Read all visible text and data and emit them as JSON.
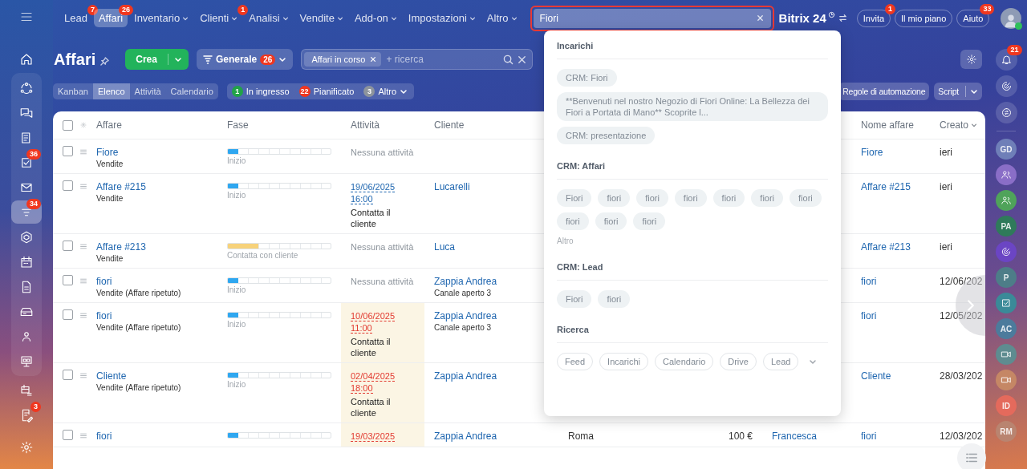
{
  "topbar": {
    "nav": [
      {
        "label": "Lead",
        "badge": "7",
        "selected": false,
        "dropdown": false
      },
      {
        "label": "Affari",
        "badge": "26",
        "selected": true,
        "dropdown": false
      },
      {
        "label": "Inventario",
        "selected": false,
        "dropdown": true
      },
      {
        "label": "Clienti",
        "badge": "1",
        "selected": false,
        "dropdown": true
      },
      {
        "label": "Analisi",
        "selected": false,
        "dropdown": true
      },
      {
        "label": "Vendite",
        "selected": false,
        "dropdown": true
      },
      {
        "label": "Add-on",
        "selected": false,
        "dropdown": true
      },
      {
        "label": "Impostazioni",
        "selected": false,
        "dropdown": true
      },
      {
        "label": "Altro",
        "selected": false,
        "dropdown": true
      }
    ],
    "search": {
      "value": "Fiori",
      "highlighted": true
    },
    "logo": {
      "name": "Bitrix",
      "number": "24"
    },
    "buttons": [
      {
        "label": "Invita",
        "badge": "1"
      },
      {
        "label": "Il mio piano"
      },
      {
        "label": "Aiuto",
        "badge": "33"
      }
    ]
  },
  "sidebar": {
    "home": {
      "kind": "home",
      "selected": false
    },
    "group": [
      {
        "kind": "network",
        "selected": false
      },
      {
        "kind": "chat",
        "selected": false
      },
      {
        "kind": "news",
        "selected": false
      },
      {
        "kind": "task",
        "badge": "36",
        "selected": false
      },
      {
        "kind": "mail",
        "selected": false
      },
      {
        "kind": "funnel",
        "badge": "34",
        "selected": true
      },
      {
        "kind": "hexagon",
        "selected": false
      },
      {
        "kind": "calendar",
        "selected": false
      },
      {
        "kind": "document",
        "selected": false
      },
      {
        "kind": "drive",
        "selected": false
      },
      {
        "kind": "people",
        "selected": false
      },
      {
        "kind": "board",
        "selected": false
      }
    ],
    "rest": [
      {
        "kind": "calendar-list",
        "selected": false
      },
      {
        "kind": "edit",
        "badge": "3",
        "selected": false
      }
    ],
    "settings": {
      "kind": "gear",
      "selected": false
    }
  },
  "header": {
    "title": "Affari",
    "create": "Crea",
    "filter": {
      "label": "Generale",
      "badge": "26"
    },
    "search": {
      "chips": [
        "Affari in corso"
      ],
      "placeholder": "+ ricerca"
    },
    "views": [
      {
        "label": "Kanban",
        "selected": false
      },
      {
        "label": "Elenco",
        "selected": true
      },
      {
        "label": "Attività",
        "selected": false
      },
      {
        "label": "Calendario",
        "selected": false
      }
    ],
    "counters": [
      {
        "count": "1",
        "label": "In ingresso",
        "color": "#21a348",
        "dropdown": false
      },
      {
        "count": "22",
        "label": "Pianificato",
        "color": "#f0371f",
        "dropdown": false
      },
      {
        "count": "3",
        "label": "Altro",
        "color": "#8d949c",
        "dropdown": true
      }
    ],
    "automation": "Regole di automazione",
    "script": "Script"
  },
  "table": {
    "select_all": {
      "checked": false
    },
    "headers": {
      "deal": "Affare",
      "stage": "Fase",
      "activity": "Attività",
      "client": "Cliente",
      "deal_name": "Nome affare",
      "created": "Creato"
    },
    "rows": [
      {
        "checked": false,
        "name": "Fiore",
        "pipeline": "Vendite",
        "stage": {
          "level": 0.1,
          "label": "Inizio",
          "color": "#2fa7f0"
        },
        "activity": {
          "kind": "none",
          "text": "Nessuna attività"
        },
        "deal_name": "Fiore",
        "created": "ieri"
      },
      {
        "checked": false,
        "name": "Affare #215",
        "pipeline": "Vendite",
        "stage": {
          "level": 0.1,
          "label": "Inizio",
          "color": "#2fa7f0"
        },
        "activity": {
          "kind": "scheduled",
          "date": "19/06/2025",
          "time": "16:00",
          "text": "Contatta il cliente",
          "overdue": false
        },
        "client": "Lucarelli",
        "deal_name": "Affare #215",
        "created": "ieri"
      },
      {
        "checked": false,
        "name": "Affare #213",
        "pipeline": "Vendite",
        "stage": {
          "level": 0.3,
          "label": "Contatta con cliente",
          "color": "#f7d27a"
        },
        "activity": {
          "kind": "none",
          "text": "Nessuna attività"
        },
        "client": "Luca",
        "deal_name": "Affare #213",
        "created": "ieri"
      },
      {
        "name": "fiori",
        "pipeline": "Vendite (Affare ripetuto)",
        "stage": {
          "level": 0.1,
          "label": "Inizio",
          "color": "#2fa7f0"
        },
        "activity": {
          "kind": "none",
          "text": "Nessuna attività"
        },
        "checked": false,
        "client": "Zappia Andrea",
        "client_sub": "Canale aperto 3",
        "deal_name": "fiori",
        "created": "12/06/202"
      },
      {
        "name": "fiori",
        "pipeline": "Vendite (Affare ripetuto)",
        "stage": {
          "level": 0.1,
          "label": "Inizio",
          "color": "#2fa7f0"
        },
        "activity": {
          "kind": "scheduled",
          "date": "10/06/2025",
          "time": "11:00",
          "text": "Contatta il cliente",
          "overdue": true
        },
        "checked": false,
        "client": "Zappia Andrea",
        "client_sub": "Canale aperto 3",
        "deal_name": "fiori",
        "created": "12/05/202"
      },
      {
        "checked": false,
        "name": "Cliente",
        "pipeline": "Vendite (Affare ripetuto)",
        "stage": {
          "level": 0.1,
          "label": "Inizio",
          "color": "#2fa7f0"
        },
        "activity": {
          "kind": "scheduled",
          "date": "02/04/2025",
          "time": "18:00",
          "text": "Contatta il cliente",
          "overdue": true
        },
        "client": "Zappia Andrea",
        "deal_name": "Cliente",
        "created": "28/03/202"
      },
      {
        "checked": false,
        "name": "fiori",
        "stage": {
          "level": 0.1,
          "color": "#2fa7f0"
        },
        "activity": {
          "kind": "scheduled",
          "date": "19/03/2025",
          "overdue": true
        },
        "client": "Zappia Andrea",
        "column_5": "Roma",
        "column_6": "100 €",
        "column_7": "Francesca",
        "deal_name": "fiori",
        "created": "12/03/202"
      }
    ]
  },
  "dropdown": {
    "sections": [
      {
        "title": "Incarichi",
        "kind": "stacked",
        "items": [
          "CRM: Fiori",
          "**Benvenuti nel nostro Negozio di Fiori Online: La Bellezza dei Fiori a Portata di Mano** Scoprite l...",
          "CRM: presentazione"
        ]
      },
      {
        "title": "CRM: Affari",
        "kind": "inline",
        "items": [
          "Fiori",
          "fiori",
          "fiori",
          "fiori",
          "fiori",
          "fiori",
          "fiori",
          "fiori",
          "fiori",
          "fiori"
        ],
        "more": "Altro"
      },
      {
        "title": "CRM: Lead",
        "kind": "inline",
        "items": [
          "Fiori",
          "fiori"
        ]
      },
      {
        "title": "Ricerca",
        "kind": "outline",
        "items": [
          "Feed",
          "Incarichi",
          "Calendario",
          "Drive",
          "Lead"
        ]
      }
    ]
  },
  "rightbar": {
    "bell": {
      "badge": "21"
    },
    "tools": [
      {
        "kind": "target"
      },
      {
        "kind": "chat-swap"
      }
    ],
    "contacts": [
      {
        "kind": "initials",
        "text": "GD",
        "color": "#6f7fb8"
      },
      {
        "kind": "group",
        "color": "#8a6ec7"
      },
      {
        "kind": "group",
        "color": "#4fa35a"
      },
      {
        "kind": "initials",
        "text": "PA",
        "color": "#2f7a5a"
      },
      {
        "kind": "target",
        "color": "#6b45c4"
      },
      {
        "kind": "initials",
        "text": "P",
        "color": "#4d7d88"
      },
      {
        "kind": "task",
        "color": "#3a8a98"
      },
      {
        "kind": "initials",
        "text": "AC",
        "color": "#4c7b9c"
      },
      {
        "kind": "video",
        "color": "#5e8c90"
      },
      {
        "kind": "video",
        "color": "#c58765"
      },
      {
        "kind": "initials",
        "text": "ID",
        "color": "#e46a5c"
      },
      {
        "kind": "initials",
        "text": "RM",
        "color": "#b98470"
      }
    ]
  }
}
